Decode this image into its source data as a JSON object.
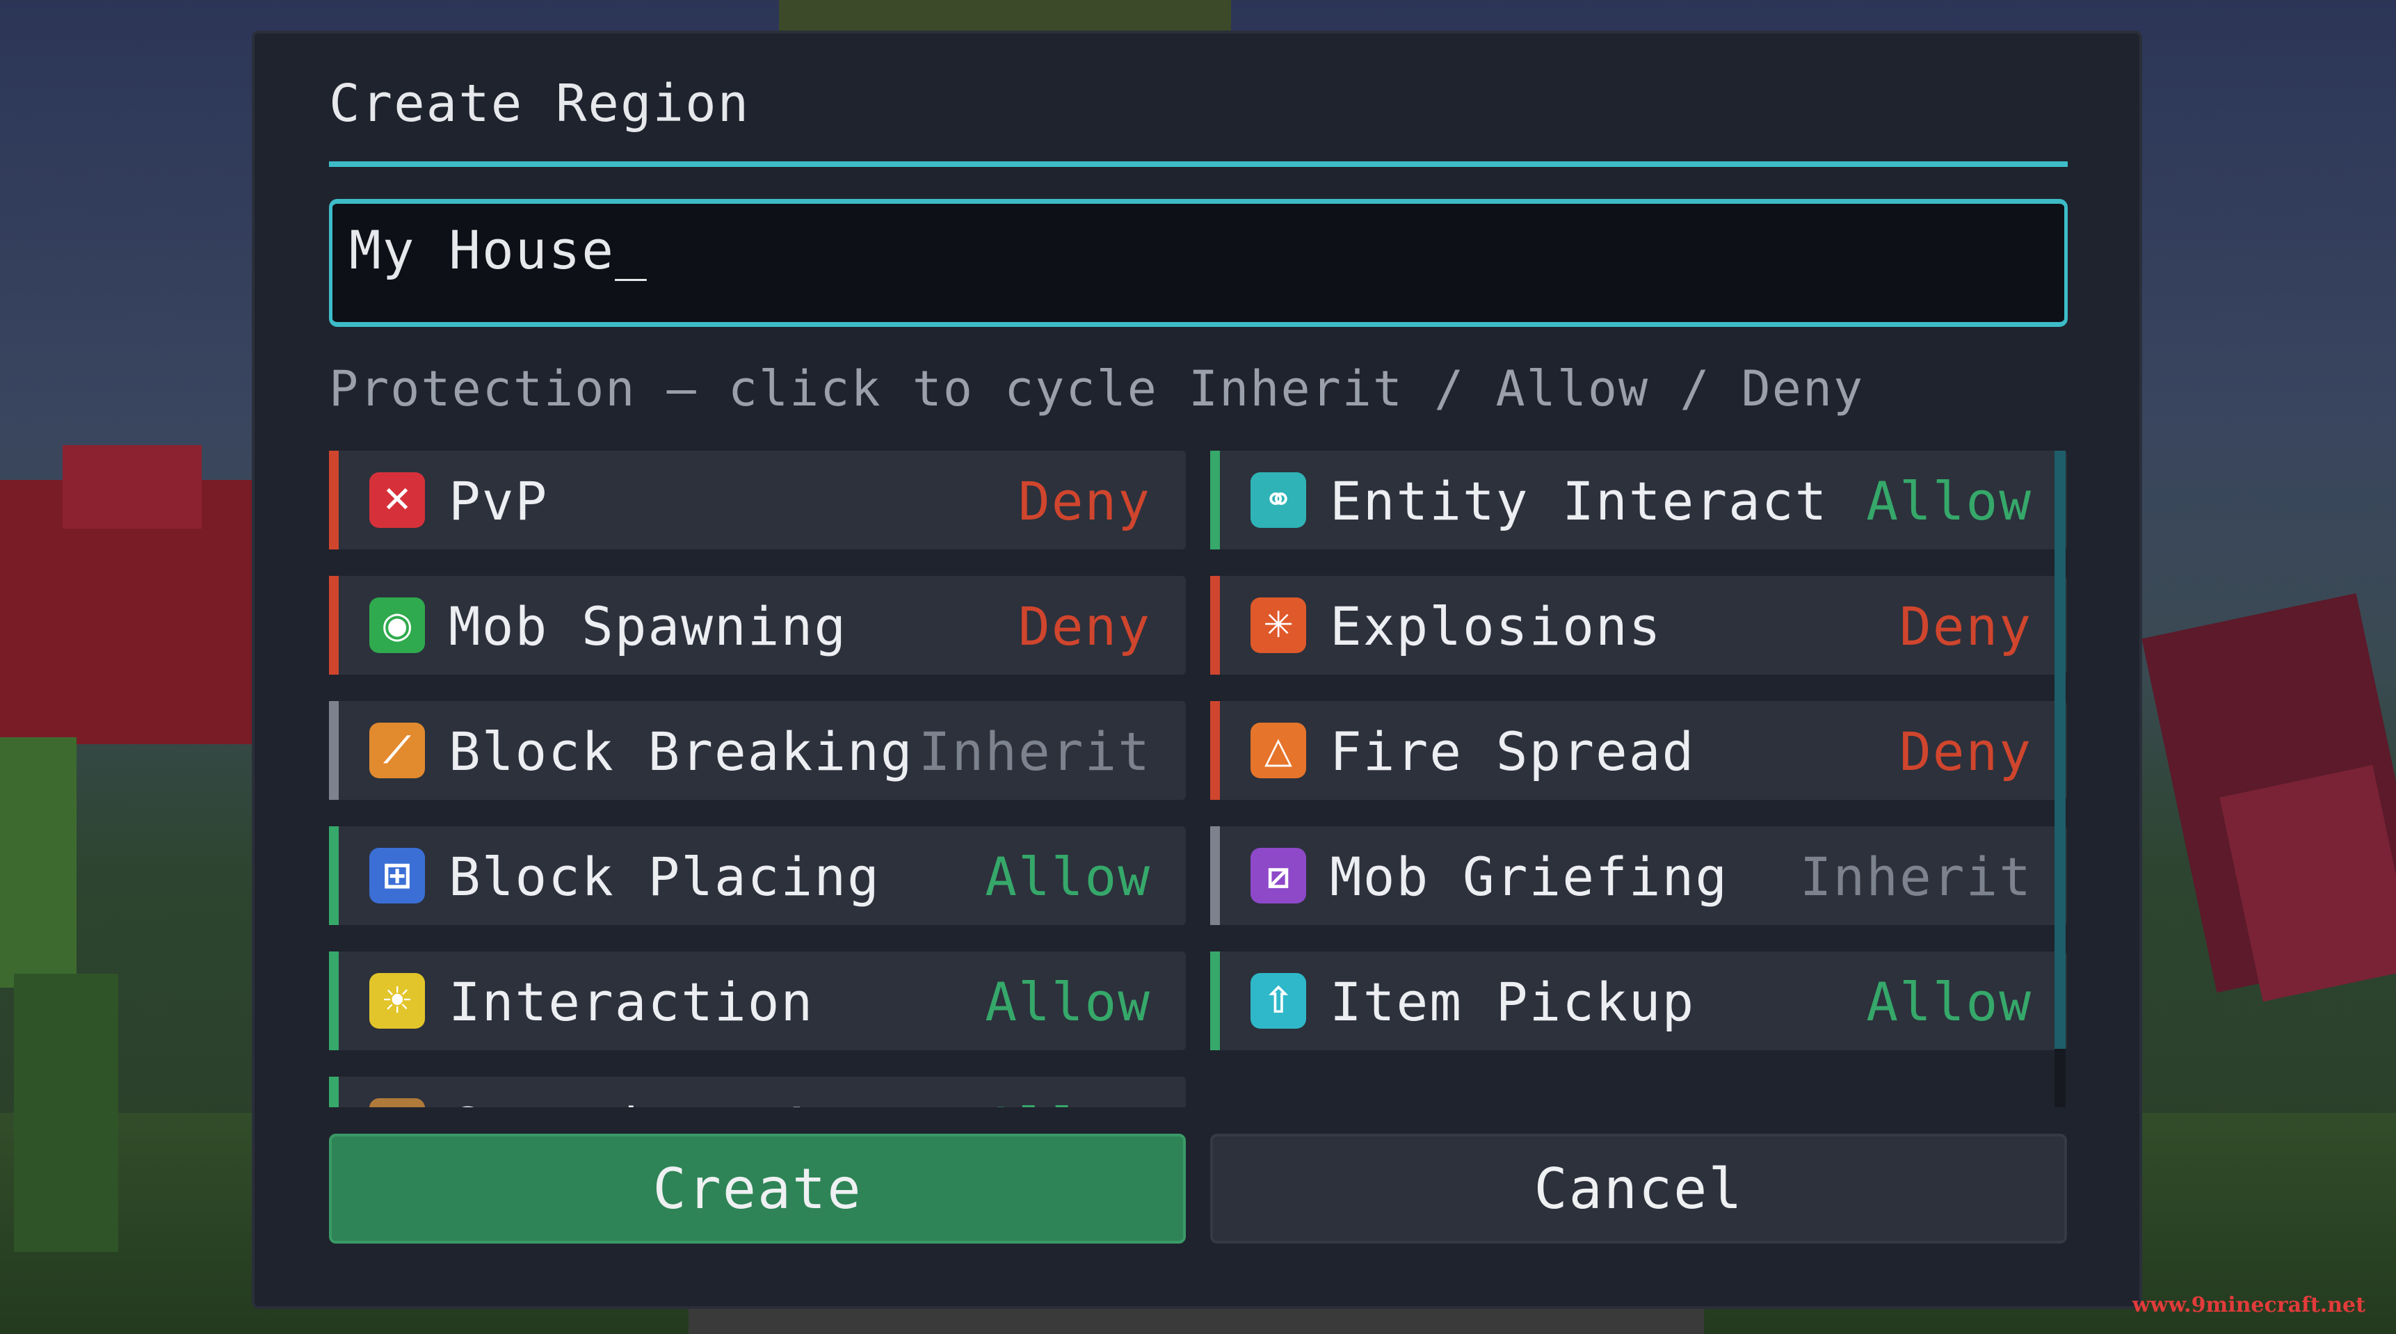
{
  "dialog": {
    "title": "Create Region",
    "name_input": {
      "value": "My House",
      "caret": "_"
    },
    "hint": "Protection — click to cycle Inherit / Allow / Deny"
  },
  "state_colors": {
    "Deny": "#d0452d",
    "Allow": "#36a86a",
    "Inherit": "#7d838e"
  },
  "flags": [
    {
      "label": "PvP",
      "state": "Deny",
      "icon": "cross-icon",
      "icon_color": "#d6313a",
      "glyph": "✕"
    },
    {
      "label": "Entity Interact",
      "state": "Allow",
      "icon": "link-icon",
      "icon_color": "#2fb3b6",
      "glyph": "⚭"
    },
    {
      "label": "Mob Spawning",
      "state": "Deny",
      "icon": "spawn-icon",
      "icon_color": "#2faa4e",
      "glyph": "◉"
    },
    {
      "label": "Explosions",
      "state": "Deny",
      "icon": "explosion-icon",
      "icon_color": "#e0592a",
      "glyph": "✳"
    },
    {
      "label": "Block Breaking",
      "state": "Inherit",
      "icon": "pickaxe-icon",
      "icon_color": "#e28a2e",
      "glyph": "⟋"
    },
    {
      "label": "Fire Spread",
      "state": "Deny",
      "icon": "flame-icon",
      "icon_color": "#e6742a",
      "glyph": "△"
    },
    {
      "label": "Block Placing",
      "state": "Allow",
      "icon": "block-icon",
      "icon_color": "#3b6fd6",
      "glyph": "⊞"
    },
    {
      "label": "Mob Griefing",
      "state": "Inherit",
      "icon": "griefing-icon",
      "icon_color": "#8e49c9",
      "glyph": "⧄"
    },
    {
      "label": "Interaction",
      "state": "Allow",
      "icon": "sun-icon",
      "icon_color": "#e2c52a",
      "glyph": "☀"
    },
    {
      "label": "Item Pickup",
      "state": "Allow",
      "icon": "pickup-icon",
      "icon_color": "#2fb8c9",
      "glyph": "⇧"
    },
    {
      "label": "Container Access",
      "state": "Allow",
      "icon": "chest-icon",
      "icon_color": "#b07a3a",
      "glyph": "▭"
    }
  ],
  "buttons": {
    "create": "Create",
    "cancel": "Cancel"
  },
  "watermark": "www.9minecraft.net"
}
